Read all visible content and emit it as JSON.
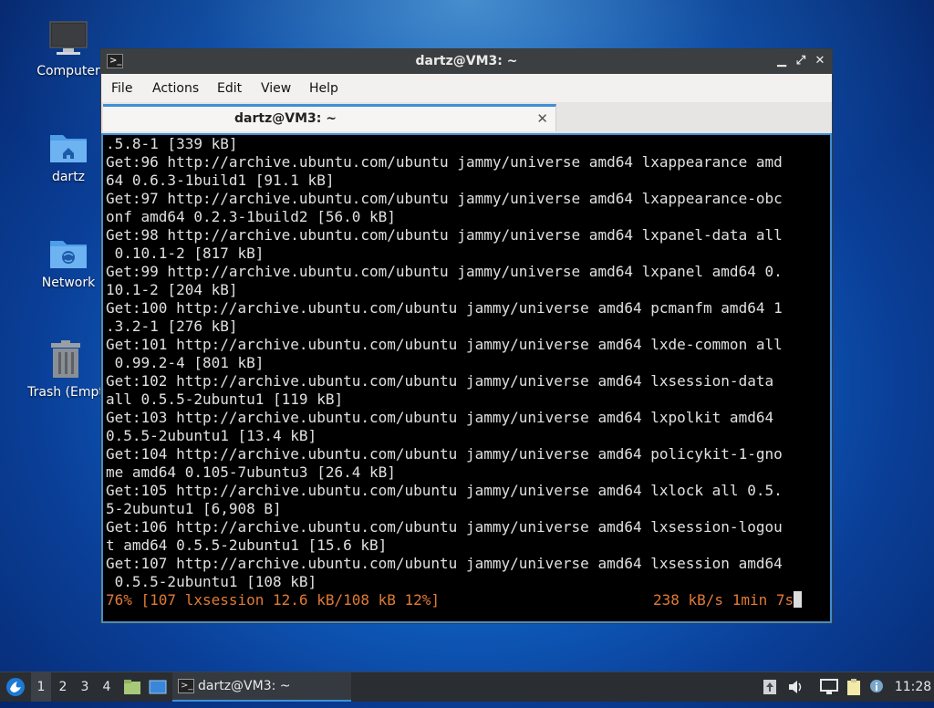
{
  "desktop": {
    "icons": [
      {
        "label": "Computer"
      },
      {
        "label": "dartz"
      },
      {
        "label": "Network"
      },
      {
        "label": "Trash (Empt"
      }
    ]
  },
  "window": {
    "title": "dartz@VM3: ~",
    "controls": {
      "minimize": "▁",
      "maximize": "⤢",
      "close": "✕"
    },
    "menu": [
      "File",
      "Actions",
      "Edit",
      "View",
      "Help"
    ],
    "tab": {
      "label": "dartz@VM3: ~",
      "close": "✕"
    }
  },
  "terminal": {
    "lines": [
      ".5.8-1 [339 kB]",
      "Get:96 http://archive.ubuntu.com/ubuntu jammy/universe amd64 lxappearance amd",
      "64 0.6.3-1build1 [91.1 kB]",
      "Get:97 http://archive.ubuntu.com/ubuntu jammy/universe amd64 lxappearance-obc",
      "onf amd64 0.2.3-1build2 [56.0 kB]",
      "Get:98 http://archive.ubuntu.com/ubuntu jammy/universe amd64 lxpanel-data all",
      " 0.10.1-2 [817 kB]",
      "Get:99 http://archive.ubuntu.com/ubuntu jammy/universe amd64 lxpanel amd64 0.",
      "10.1-2 [204 kB]",
      "Get:100 http://archive.ubuntu.com/ubuntu jammy/universe amd64 pcmanfm amd64 1",
      ".3.2-1 [276 kB]",
      "Get:101 http://archive.ubuntu.com/ubuntu jammy/universe amd64 lxde-common all",
      " 0.99.2-4 [801 kB]",
      "Get:102 http://archive.ubuntu.com/ubuntu jammy/universe amd64 lxsession-data",
      "all 0.5.5-2ubuntu1 [119 kB]",
      "Get:103 http://archive.ubuntu.com/ubuntu jammy/universe amd64 lxpolkit amd64",
      "0.5.5-2ubuntu1 [13.4 kB]",
      "Get:104 http://archive.ubuntu.com/ubuntu jammy/universe amd64 policykit-1-gno",
      "me amd64 0.105-7ubuntu3 [26.4 kB]",
      "Get:105 http://archive.ubuntu.com/ubuntu jammy/universe amd64 lxlock all 0.5.",
      "5-2ubuntu1 [6,908 B]",
      "Get:106 http://archive.ubuntu.com/ubuntu jammy/universe amd64 lxsession-logou",
      "t amd64 0.5.5-2ubuntu1 [15.6 kB]",
      "Get:107 http://archive.ubuntu.com/ubuntu jammy/universe amd64 lxsession amd64",
      " 0.5.5-2ubuntu1 [108 kB]"
    ],
    "progress": "76% [107 lxsession 12.6 kB/108 kB 12%]",
    "rate": "238 kB/s 1min 7s"
  },
  "taskbar": {
    "workspaces": [
      "1",
      "2",
      "3",
      "4"
    ],
    "active_workspace": "1",
    "task_label": "dartz@VM3: ~",
    "clock": "11:28"
  },
  "colors": {
    "accent": "#3d8fd6",
    "progress_text": "#e07a36",
    "terminal_bg": "#000000"
  }
}
